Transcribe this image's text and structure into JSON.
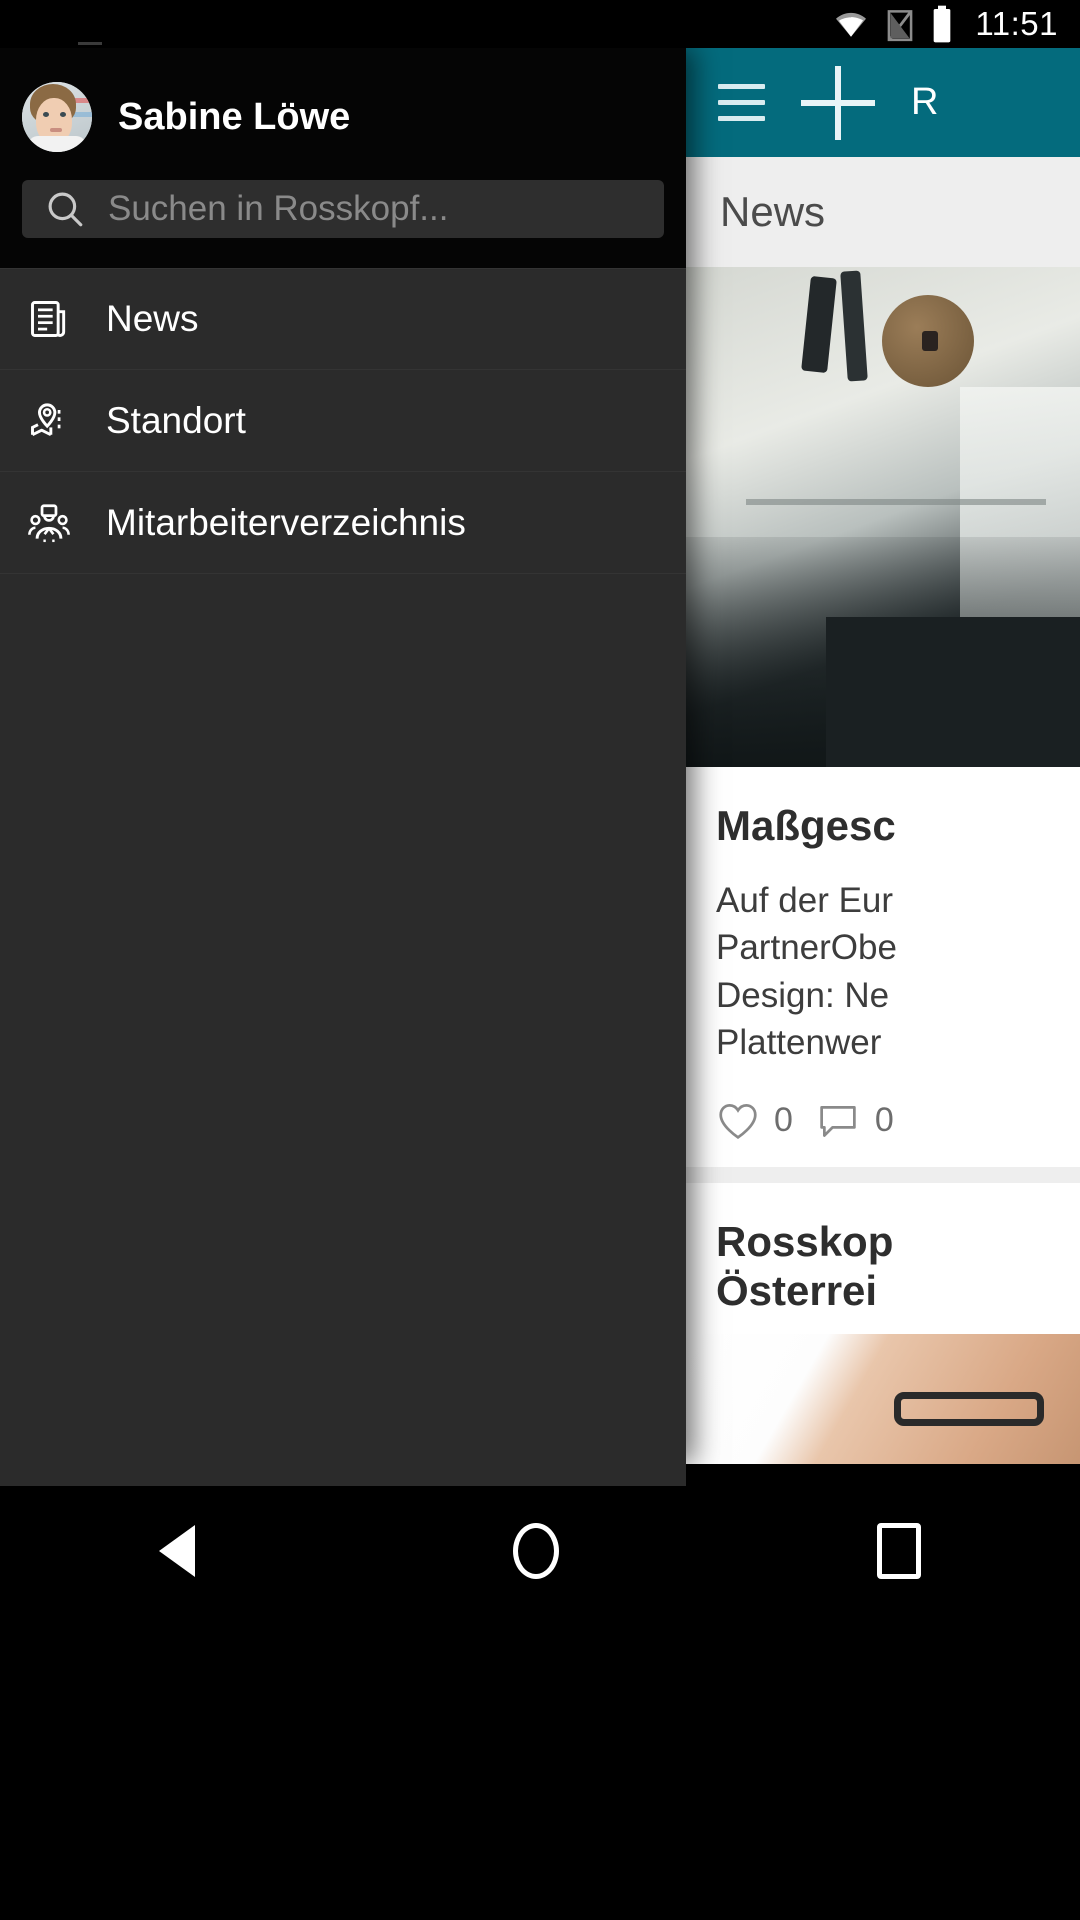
{
  "status_bar": {
    "time": "11:51",
    "icons": [
      "wifi-icon",
      "sim-off-icon",
      "battery-icon"
    ]
  },
  "drawer": {
    "user": {
      "name": "Sabine Löwe",
      "avatar": "user-avatar"
    },
    "search": {
      "placeholder": "Suchen in Rosskopf...",
      "icon": "search-icon",
      "value": ""
    },
    "items": [
      {
        "label": "News",
        "icon": "newspaper-icon"
      },
      {
        "label": "Standort",
        "icon": "map-pin-icon"
      },
      {
        "label": "Mitarbeiterverzeichnis",
        "icon": "people-group-icon"
      }
    ]
  },
  "app": {
    "appbar": {
      "menu_icon": "hamburger-menu-icon",
      "add_icon": "plus-icon",
      "title": "R"
    },
    "section_title": "News",
    "articles": [
      {
        "title": "Maßgesc",
        "body_lines": [
          "Auf der Eur",
          "PartnerObe",
          "Design: Ne",
          "Plattenwer"
        ],
        "likes": "0",
        "comments": "0",
        "like_icon": "heart-icon",
        "comment_icon": "comment-bubble-icon",
        "photo": "office-interior-photo"
      },
      {
        "title_line1": "Rosskop",
        "title_line2": "Österrei",
        "photo": "person-portrait-photo"
      }
    ]
  },
  "android_nav": {
    "back": "back-triangle-icon",
    "home": "home-circle-icon",
    "recents": "recents-square-icon"
  },
  "colors": {
    "accent_teal": "#046b7d",
    "drawer_bg": "#2b2b2b",
    "drawer_header_bg": "#050505",
    "content_bg": "#eeeeee"
  }
}
